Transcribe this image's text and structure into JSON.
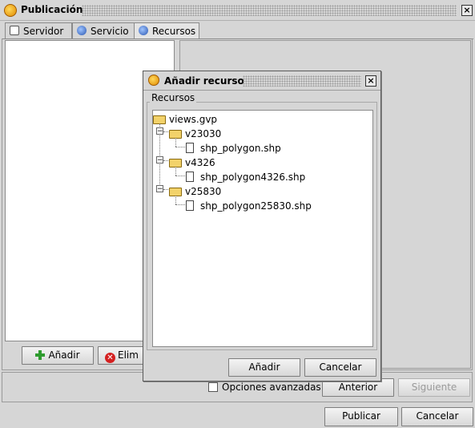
{
  "window": {
    "title": "Publicación",
    "close_label": "×"
  },
  "tabs": [
    {
      "label": "Servidor",
      "icon": "monitor-icon"
    },
    {
      "label": "Servicio",
      "icon": "globe-icon"
    },
    {
      "label": "Recursos",
      "icon": "globe-icon"
    }
  ],
  "left_panel": {
    "add_label": "Añadir",
    "remove_label": "Elim"
  },
  "wizard": {
    "advanced_options_label": "Opciones avanzadas",
    "advanced_options_checked": false,
    "previous_label": "Anterior",
    "next_label": "Siguiente",
    "publish_label": "Publicar",
    "cancel_label": "Cancelar"
  },
  "dialog": {
    "title": "Añadir recurso",
    "close_label": "×",
    "group_label": "Recursos",
    "tree": {
      "root": "views.gvp",
      "folders": [
        {
          "name": "v23030",
          "file": "shp_polygon.shp"
        },
        {
          "name": "v4326",
          "file": "shp_polygon4326.shp"
        },
        {
          "name": "v25830",
          "file": "shp_polygon25830.shp"
        }
      ]
    },
    "add_label": "Añadir",
    "cancel_label": "Cancelar"
  },
  "colors": {
    "background": "#d6d6d6",
    "app_icon": "#e08a00",
    "folder": "#f2d26a"
  }
}
